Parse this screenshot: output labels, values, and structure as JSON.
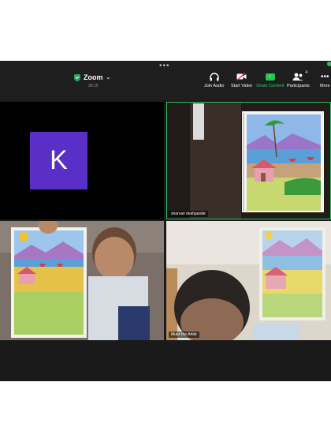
{
  "header": {
    "app_name": "Zoom",
    "timer": "36:15",
    "more_dots": "•••"
  },
  "toolbar": {
    "join_audio": "Join Audio",
    "start_video": "Start Video",
    "share_content": "Share Content",
    "participants": "Participants",
    "participant_count": "4",
    "more": "More"
  },
  "tiles": [
    {
      "avatar_letter": "K",
      "avatar_color": "#5a2fc8"
    },
    {
      "name": "sharvari deshpande"
    },
    {
      "name": ""
    },
    {
      "name": "Mukil the Artist"
    }
  ],
  "colors": {
    "accent": "#23c552",
    "active_border": "#2fbf5a"
  }
}
